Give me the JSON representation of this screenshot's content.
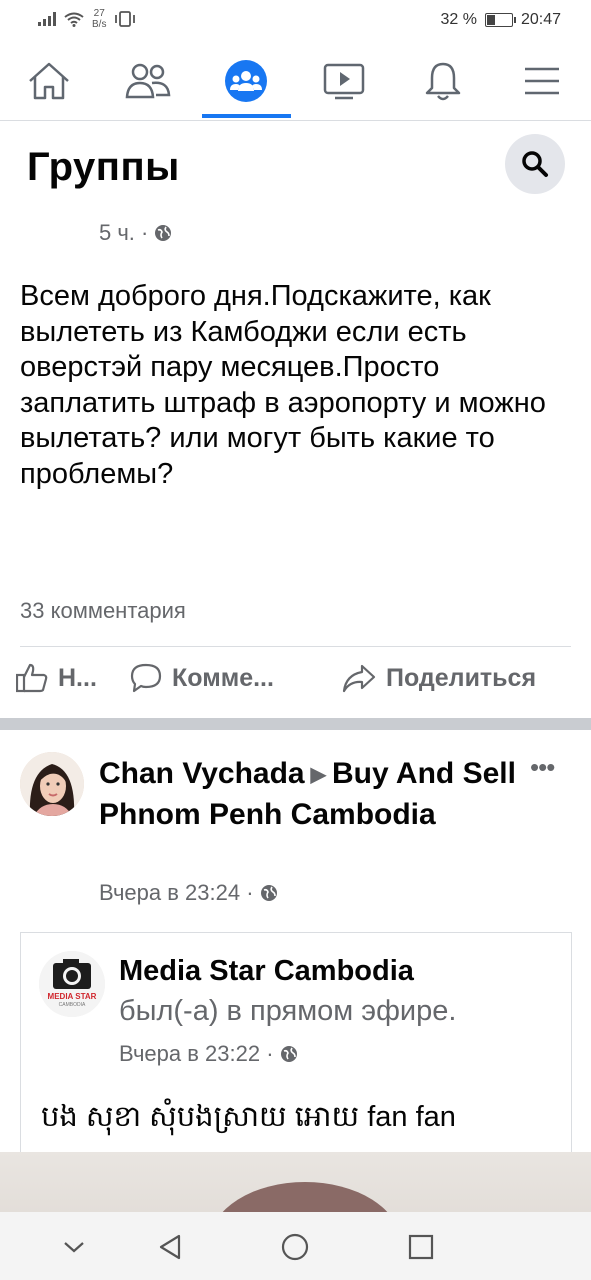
{
  "status_bar": {
    "net_speed_value": "27",
    "net_speed_unit": "B/s",
    "battery": "32 %",
    "battery_level": 0.32,
    "time": "20:47"
  },
  "nav": {
    "active": "groups"
  },
  "header": {
    "title": "Группы"
  },
  "post1": {
    "time": "5 ч. ·",
    "text": "Всем доброго дня.Подскажите, как вылететь из Камбоджи если есть оверстэй пару месяцев.Просто заплатить штраф в аэропорту и можно вылетать? или могут быть какие то проблемы?",
    "comments": "33 комментария",
    "actions": {
      "like": "Н...",
      "comment": "Комме...",
      "share": "Поделиться"
    }
  },
  "post2": {
    "author": "Chan Vychada",
    "arrow": "▶",
    "group": "Buy And Sell Phnom Penh Cambodia",
    "time": "Вчера в 23:24 ·",
    "more": "•••",
    "shared": {
      "name": "Media Star Cambodia",
      "logo_text": "MEDIA STAR",
      "logo_sub": "CAMBODIA",
      "status": "был(-а) в прямом эфире.",
      "time": "Вчера в 23:22 ·",
      "text": "បង សុខា សុំបងស្រាយ អោយ fan fan"
    }
  },
  "colors": {
    "accent": "#1877f2",
    "secondary_text": "#65676b",
    "separator": "#c9ccd1"
  }
}
